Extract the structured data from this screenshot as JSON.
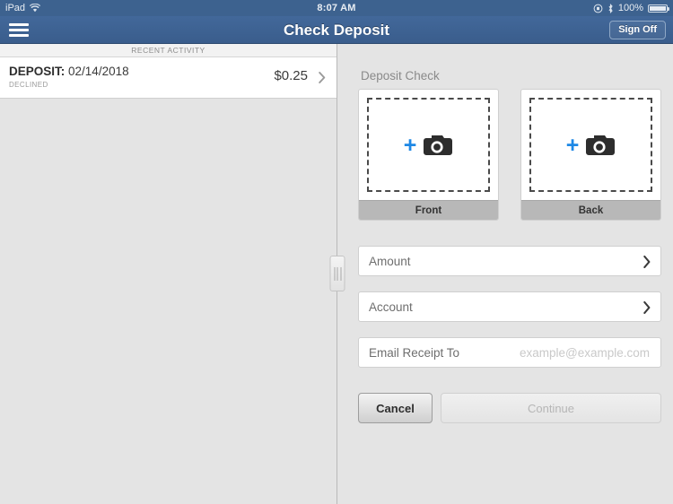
{
  "status_bar": {
    "device": "iPad",
    "wifi_icon": "wifi-icon",
    "time": "8:07 AM",
    "rotation_lock_icon": "rotation-lock-icon",
    "bluetooth_icon": "bluetooth-icon",
    "battery_percent": "100%",
    "battery_icon": "battery-icon"
  },
  "navbar": {
    "menu_icon": "hamburger-menu-icon",
    "title": "Check Deposit",
    "signoff_label": "Sign Off",
    "background_color": "#3d628f"
  },
  "left_panel": {
    "section_header": "RECENT ACTIVITY",
    "activity": [
      {
        "label": "DEPOSIT:",
        "date": "02/14/2018",
        "status": "DECLINED",
        "amount": "$0.25",
        "chevron_icon": "chevron-right-icon"
      }
    ]
  },
  "right_panel": {
    "section_title": "Deposit Check",
    "captures": [
      {
        "label": "Front",
        "plus_icon": "plus-icon",
        "camera_icon": "camera-icon"
      },
      {
        "label": "Back",
        "plus_icon": "plus-icon",
        "camera_icon": "camera-icon"
      }
    ],
    "fields": [
      {
        "label": "Amount",
        "chevron_icon": "chevron-right-icon"
      },
      {
        "label": "Account",
        "chevron_icon": "chevron-right-icon"
      }
    ],
    "email_field": {
      "label": "Email Receipt To",
      "placeholder": "example@example.com",
      "value": ""
    },
    "buttons": {
      "cancel_label": "Cancel",
      "continue_label": "Continue"
    },
    "accent_color": "#1e88e5"
  },
  "split_handle": {
    "icon": "drag-handle-icon"
  }
}
